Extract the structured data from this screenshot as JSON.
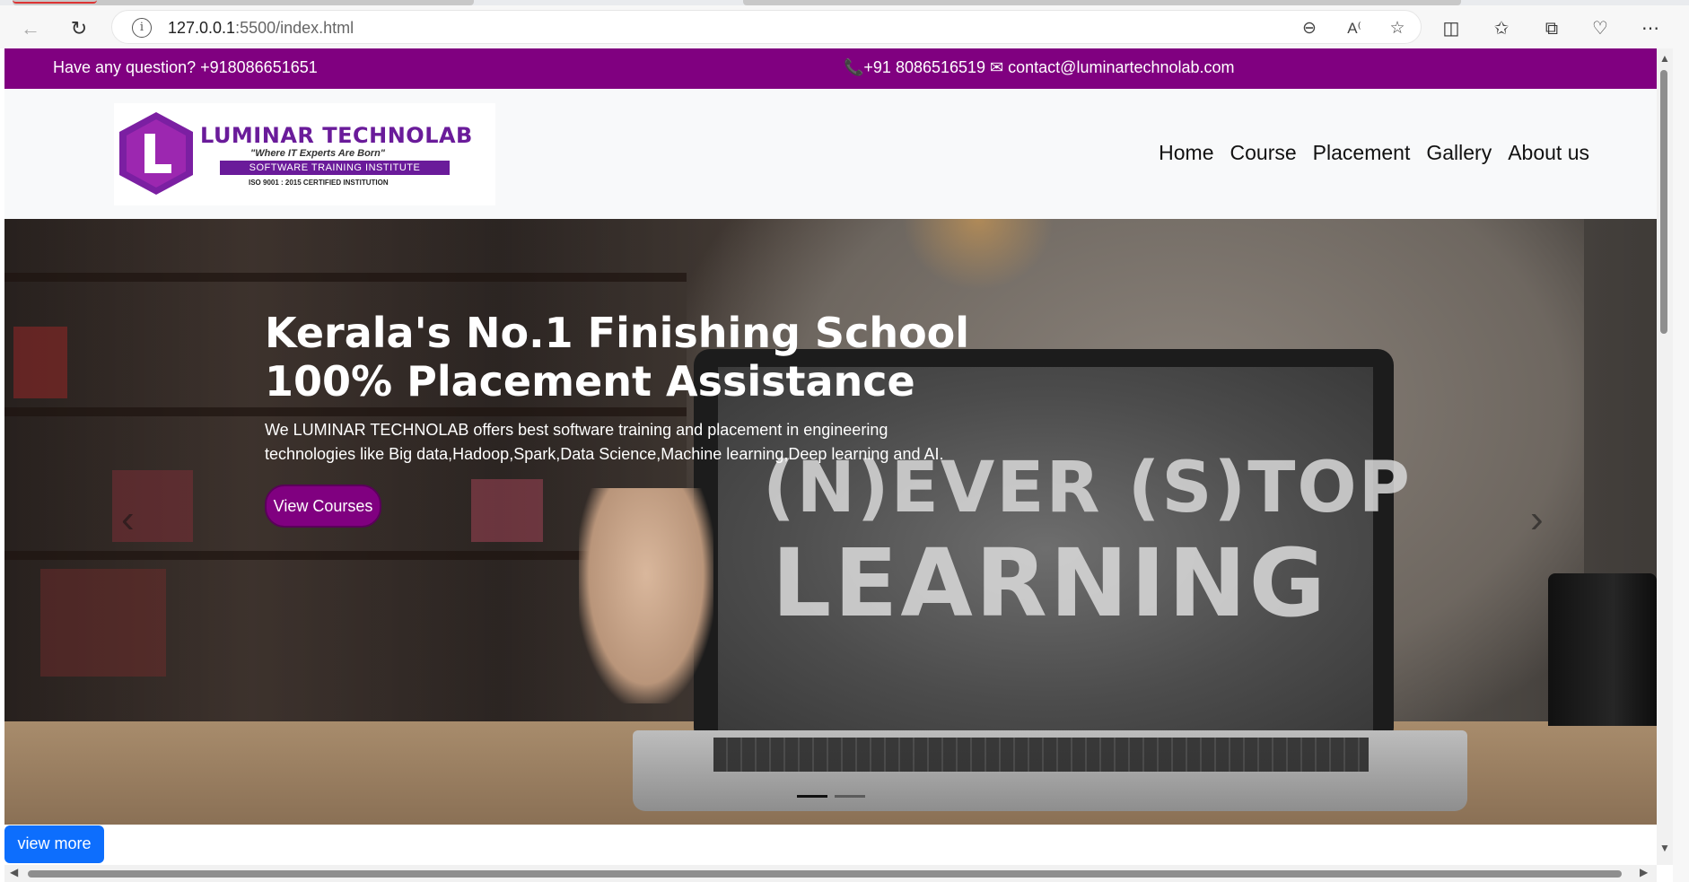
{
  "browser": {
    "url_host": "127.0.0.1",
    "url_path": ":5500/index.html"
  },
  "topbar": {
    "question": "Have any question?   +918086651651",
    "contact": "📞+91 8086516519 ✉ contact@luminartechnolab.com"
  },
  "logo": {
    "name": "LUMINAR TECHNOLAB",
    "tagline": "\"Where IT Experts Are Born\"",
    "band": "SOFTWARE TRAINING INSTITUTE",
    "iso": "ISO 9001 : 2015 CERTIFIED INSTITUTION"
  },
  "nav": {
    "items": [
      "Home",
      "Course",
      "Placement",
      "Gallery",
      "About us"
    ]
  },
  "hero": {
    "title_line1": "Kerala's No.1 Finishing School",
    "title_line2": "100% Placement Assistance",
    "text": "We LUMINAR TECHNOLAB offers best software training and placement in engineering technologies like Big data,Hadoop,Spark,Data Science,Machine learning,Deep learning and AI.",
    "button": "View Courses",
    "chalk_line1": "(N)EVER (S)TOP",
    "chalk_line2": "LEARNING"
  },
  "view_more": "view more",
  "colors": {
    "brand_purple": "#800080",
    "primary_blue": "#0d6efd"
  }
}
